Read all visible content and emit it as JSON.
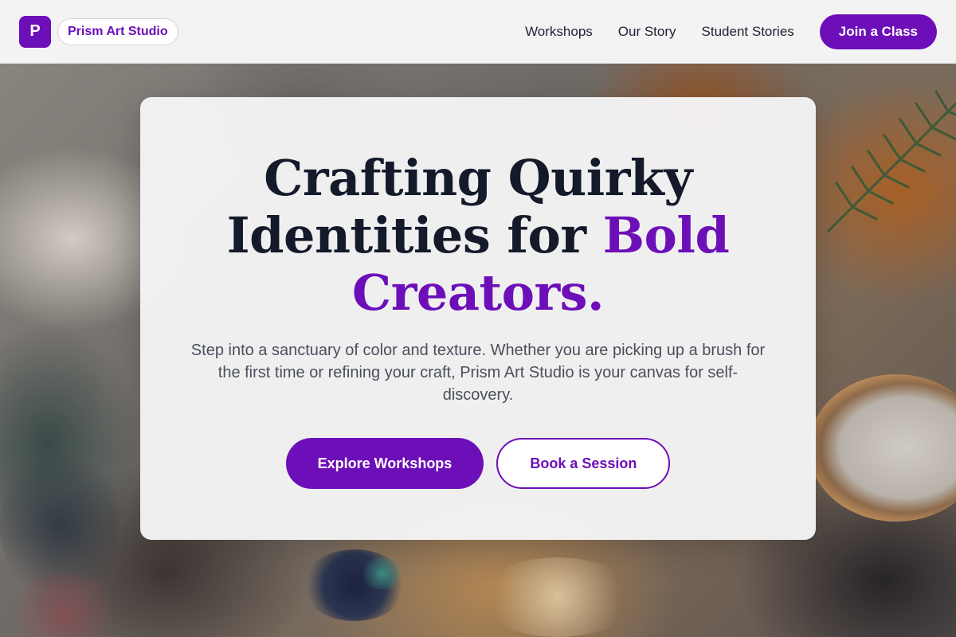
{
  "brand": {
    "logo_letter": "P",
    "name": "Prism Art Studio",
    "accent_color": "#6d0fb8"
  },
  "nav": {
    "links": [
      {
        "label": "Workshops"
      },
      {
        "label": "Our Story"
      },
      {
        "label": "Student Stories"
      }
    ],
    "cta_label": "Join a Class"
  },
  "hero": {
    "headline_part1": "Crafting Quirky",
    "headline_part2": "Identities for ",
    "headline_accent1": "Bold",
    "headline_accent2": "Creators.",
    "lead": "Step into a sanctuary of color and texture. Whether you are picking up a brush for the first time or refining your craft, Prism Art Studio is your canvas for self-discovery.",
    "primary_button": "Explore Workshops",
    "secondary_button": "Book a Session"
  }
}
